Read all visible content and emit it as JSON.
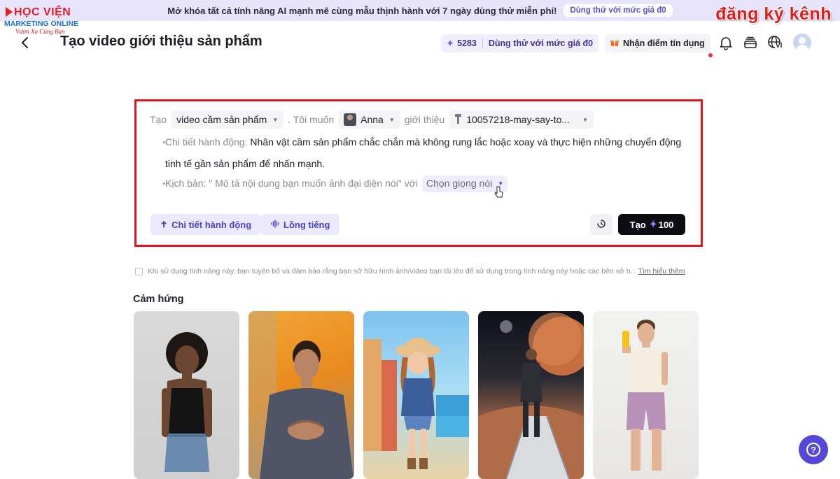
{
  "promo": {
    "text": "Mở khóa tất cả tính năng AI mạnh mẽ cùng mẫu thịnh hành với 7 ngày dùng thử miễn phí!",
    "button": "Dùng thử với mức giá đ0"
  },
  "watermark": {
    "brand_line1": "HỌC VIỆN",
    "brand_line2": "MARKETING ONLINE",
    "brand_slogan": "Vươn Xa Cùng Bạn",
    "subscribe": "đăng ký kênh"
  },
  "header": {
    "title": "Tạo video giới thiệu sản phẩm",
    "credits": "5283",
    "trial_button": "Dùng thử với mức giá đ0",
    "reward_button": "Nhận điểm tín dụng",
    "language": "VI"
  },
  "prompt": {
    "create_word": "Tạo",
    "template_value": "video cầm sản phẩm",
    "want_word": ". Tôi muốn",
    "avatar_value": "Anna",
    "introduce_word": "giới thiệu",
    "product_value": "10057218-may-say-to...",
    "action_label": "Chi tiết hành động:",
    "action_text": "Nhân vật cầm sản phẩm chắc chắn mà không rung lắc hoặc xoay và thực hiện những chuyển động tinh tế gần sản phẩm để nhấn mạnh.",
    "script_label": "Kịch bản:",
    "script_placeholder": "\" Mô tả nội dung bạn muốn ảnh đại diện nói\"",
    "with_word": "với",
    "voice_value": "Chọn giọng nói",
    "action_button": "Chi tiết hành động",
    "dub_button": "Lồng tiếng",
    "create_button": "Tạo",
    "create_cost": "100"
  },
  "disclaimer": {
    "text": "Khi sử dụng tính năng này, bạn tuyên bố và đảm bảo rằng bạn sở hữu hình ảnh/video bạn tải lên để sử dụng trong tính năng này hoặc các bên sở h...",
    "link": "Tìm hiểu thêm"
  },
  "inspiration": {
    "title": "Cảm hứng"
  },
  "colors": {
    "accent": "#5548d9",
    "highlight_border": "#e3141c",
    "promo_bg": "#e7e4fb"
  }
}
